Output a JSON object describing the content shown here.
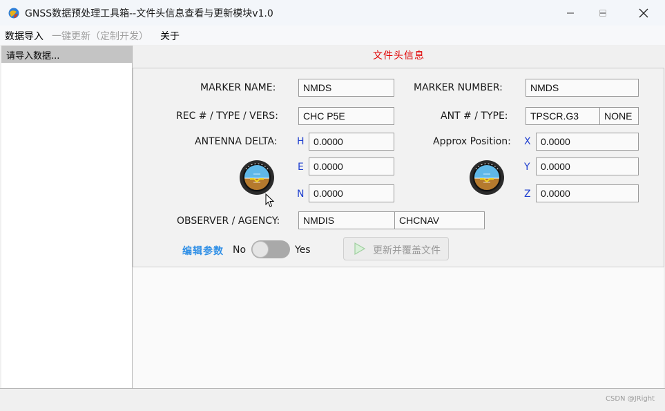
{
  "window": {
    "title": "GNSS数据预处理工具箱--文件头信息查看与更新模块v1.0",
    "minimize": "—",
    "maximize": "☐",
    "close": "✕"
  },
  "menu": {
    "import": "数据导入",
    "update": "一键更新（定制开发）",
    "about": "关于"
  },
  "left_panel": {
    "header": "请导入数据..."
  },
  "header_section": {
    "title": "文件头信息"
  },
  "fields": {
    "marker_name_label": "MARKER NAME:",
    "marker_name": "NMDS",
    "marker_number_label": "MARKER NUMBER:",
    "marker_number": "NMDS",
    "rec_label": "REC # / TYPE / VERS:",
    "rec": "CHC P5E",
    "ant_label": "ANT # / TYPE:",
    "ant_type": "TPSCR.G3",
    "ant_radome": "NONE",
    "antenna_delta_label": "ANTENNA DELTA:",
    "h_axis": "H",
    "h": "0.0000",
    "e_axis": "E",
    "e": "0.0000",
    "n_axis": "N",
    "n": "0.0000",
    "approx_label": "Approx Position:",
    "x_axis": "X",
    "x": "0.0000",
    "y_axis": "Y",
    "y": "0.0000",
    "z_axis": "Z",
    "z": "0.0000",
    "observer_label": "OBSERVER / AGENCY:",
    "observer": "NMDIS",
    "agency": "CHCNAV"
  },
  "edit": {
    "label": "编辑参数",
    "no": "No",
    "yes": "Yes",
    "toggle_state": "off",
    "update_button": "更新并覆盖文件"
  },
  "status": {
    "watermark": "CSDN @JRight"
  },
  "icons": {
    "app": "app-globe-icon",
    "gauge": "attitude-indicator-icon",
    "play": "play-icon",
    "cursor": "mouse-cursor-icon"
  },
  "colors": {
    "header_title": "#e00000",
    "axis_labels": "#1f3fcf",
    "edit_label": "#2f8fe6"
  }
}
